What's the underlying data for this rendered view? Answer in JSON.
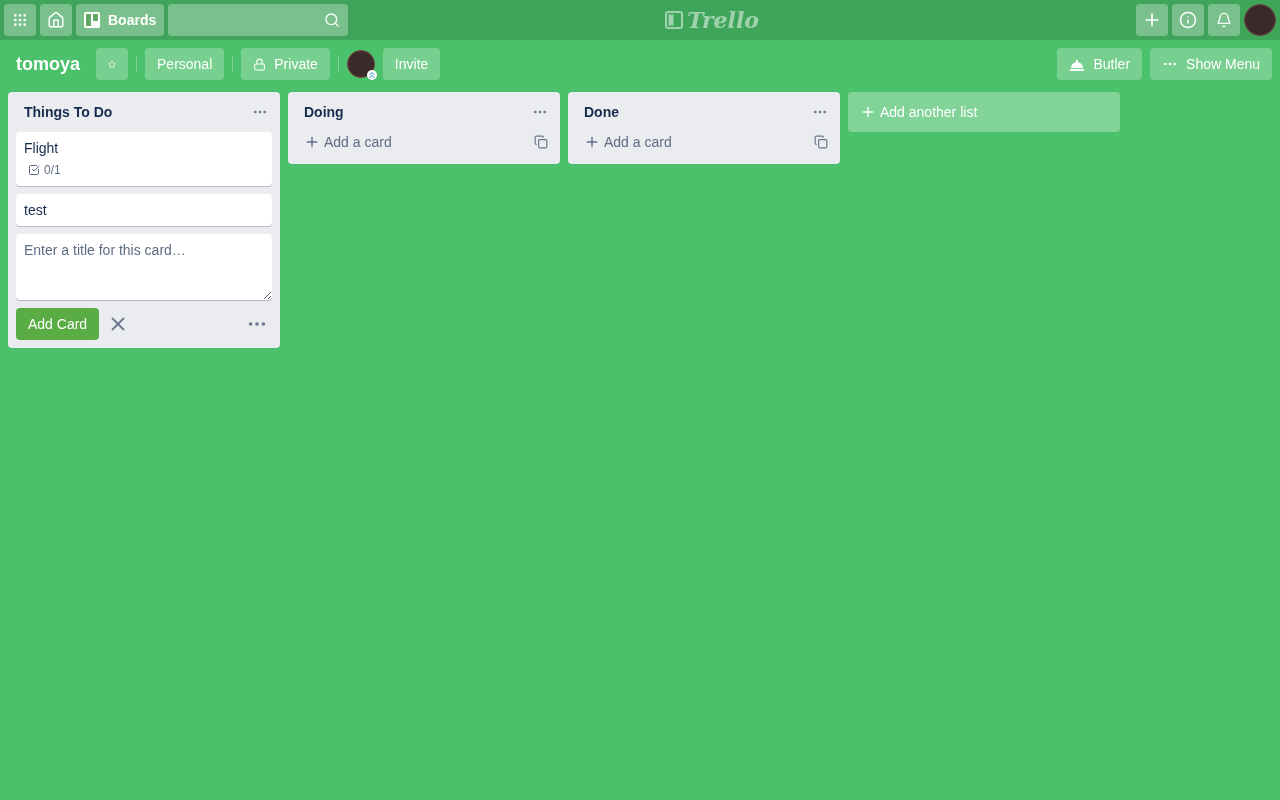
{
  "topbar": {
    "boards_label": "Boards",
    "logo": "Trello"
  },
  "board": {
    "title": "tomoya",
    "starred": false,
    "team": "Personal",
    "visibility": "Private",
    "invite": "Invite",
    "butler": "Butler",
    "show_menu": "Show Menu"
  },
  "lists": [
    {
      "title": "Things To Do",
      "cards": [
        {
          "title": "Flight",
          "checklist": "0/1"
        },
        {
          "title": "test"
        }
      ],
      "footer": {
        "kind": "composer",
        "placeholder": "Enter a title for this card…",
        "button": "Add Card"
      }
    },
    {
      "title": "Doing",
      "footer": {
        "kind": "add",
        "label": "Add a card"
      }
    },
    {
      "title": "Done",
      "footer": {
        "kind": "add",
        "label": "Add a card"
      }
    }
  ],
  "add_list": "Add another list"
}
